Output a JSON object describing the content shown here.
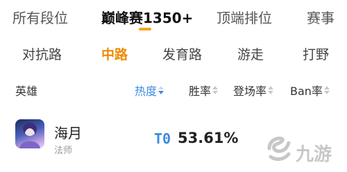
{
  "tabs": [
    "所有段位",
    "巅峰赛1350+",
    "顶端排位",
    "赛事"
  ],
  "lanes": [
    "对抗路",
    "中路",
    "发育路",
    "游走",
    "打野"
  ],
  "columns": {
    "hero": "英雄",
    "heat": "热度",
    "winrate": "胜率",
    "pickrate": "登场率",
    "banrate": "Ban率"
  },
  "hero": {
    "name": "海月",
    "role": "法师",
    "tier": "T0",
    "winrate": "53.61%"
  },
  "watermark": {
    "text": "九游"
  },
  "colors": {
    "accent_orange": "#f08a00",
    "accent_blue": "#3b8be0",
    "tab_underline": "#f5a623"
  }
}
